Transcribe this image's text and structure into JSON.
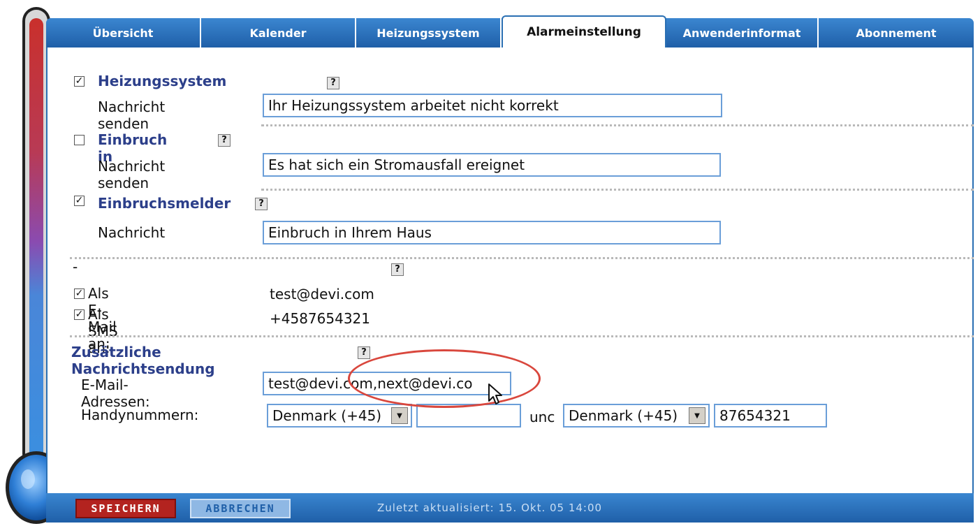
{
  "tabs": [
    {
      "label": "Übersicht",
      "active": false
    },
    {
      "label": "Kalender",
      "active": false
    },
    {
      "label": "Heizungssystem",
      "active": false
    },
    {
      "label": "Alarmeinstellung",
      "active": true
    },
    {
      "label": "Anwenderinformat",
      "active": false
    },
    {
      "label": "Abonnement",
      "active": false
    }
  ],
  "alarms": {
    "heating": {
      "checked": true,
      "title": "Heizungssystem",
      "message_label": "Nachricht senden",
      "message_value": "Ihr Heizungssystem arbeitet nicht korrekt"
    },
    "break_in": {
      "checked": false,
      "title": "Einbruch in",
      "message_label": "Nachricht senden",
      "message_value": "Es hat sich ein Stromausfall ereignet"
    },
    "burglar": {
      "checked": true,
      "title": "Einbruchsmelder",
      "message_label": "Nachricht",
      "message_value": "Einbruch in Ihrem Haus"
    }
  },
  "recipients": {
    "dash": "-",
    "email": {
      "checked": true,
      "label": "Als E-Mail an:",
      "value": "test@devi.com"
    },
    "sms": {
      "checked": true,
      "label": "Als SMS an:",
      "value": "+4587654321"
    }
  },
  "additional": {
    "title": "Zusätzliche Nachrichtsendung",
    "email_label": "E-Mail-Adressen:",
    "email_value": "test@devi.com,next@devi.co",
    "phone_label": "Handynummern:",
    "phone1_country": "Denmark (+45)",
    "phone1_number": "",
    "and_label": "unc",
    "phone2_country": "Denmark (+45)",
    "phone2_number": "87654321"
  },
  "help_glyph": "?",
  "check_glyph": "✓",
  "footer": {
    "save_label": "SPEICHERN",
    "cancel_label": "ABBRECHEN",
    "status": "Zuletzt aktualisiert: 15. Okt. 05 14:00"
  },
  "colors": {
    "tab_blue": "#2a6fb3",
    "label_blue": "#2c3f8a",
    "save_red": "#b3231f",
    "highlight_oval": "#d9473d"
  }
}
